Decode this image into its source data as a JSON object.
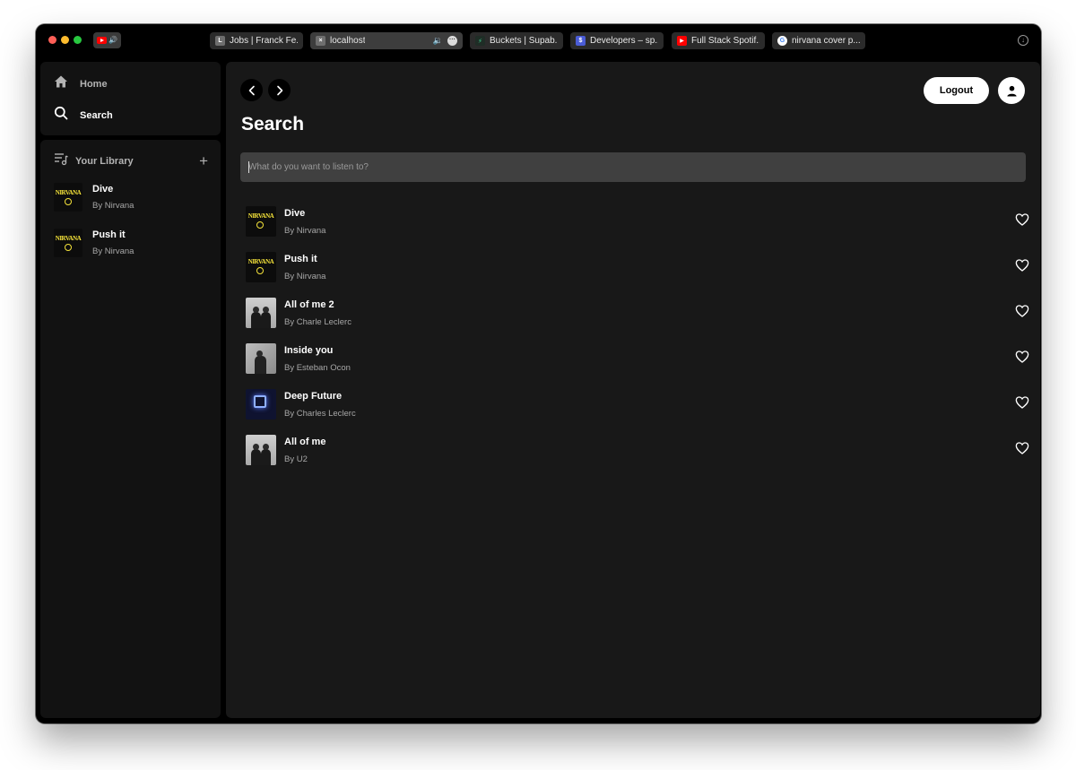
{
  "browser": {
    "tabs": [
      {
        "label": "Jobs | Franck Fe...",
        "favicon": "L",
        "color": "#6e6e6e"
      },
      {
        "label": "localhost",
        "favicon": "×",
        "color": "#6e6e6e"
      },
      {
        "label": "Buckets | Supab...",
        "favicon": "⚡",
        "color": "#1f2d26"
      },
      {
        "label": "Developers – sp...",
        "favicon": "$",
        "color": "#4a5cd6"
      },
      {
        "label": "Full Stack Spotif...",
        "favicon": "▶",
        "color": "#ff0000"
      },
      {
        "label": "nirvana cover p...",
        "favicon": "G",
        "color": "#ffffff"
      }
    ]
  },
  "sidebar": {
    "nav": {
      "home": "Home",
      "search": "Search"
    },
    "library": {
      "title": "Your Library",
      "items": [
        {
          "title": "Dive",
          "artist": "By Nirvana"
        },
        {
          "title": "Push it",
          "artist": "By Nirvana"
        }
      ]
    }
  },
  "header": {
    "logout_label": "Logout"
  },
  "main": {
    "title": "Search",
    "search_placeholder": "What do you want to listen to?",
    "results": [
      {
        "title": "Dive",
        "artist": "By Nirvana",
        "cover": "nirvana"
      },
      {
        "title": "Push it",
        "artist": "By Nirvana",
        "cover": "nirvana"
      },
      {
        "title": "All of me 2",
        "artist": "By Charle Leclerc",
        "cover": "photo-duo"
      },
      {
        "title": "Inside you",
        "artist": "By Esteban Ocon",
        "cover": "photo-single"
      },
      {
        "title": "Deep Future",
        "artist": "By Charles Leclerc",
        "cover": "future"
      },
      {
        "title": "All of me",
        "artist": "By U2",
        "cover": "photo-duo"
      }
    ]
  },
  "colors": {
    "background": "#000000",
    "panel": "#121212",
    "main_panel": "#181818",
    "input": "#404040",
    "accent_text": "#ffffff",
    "muted_text": "#a7a7a7"
  }
}
